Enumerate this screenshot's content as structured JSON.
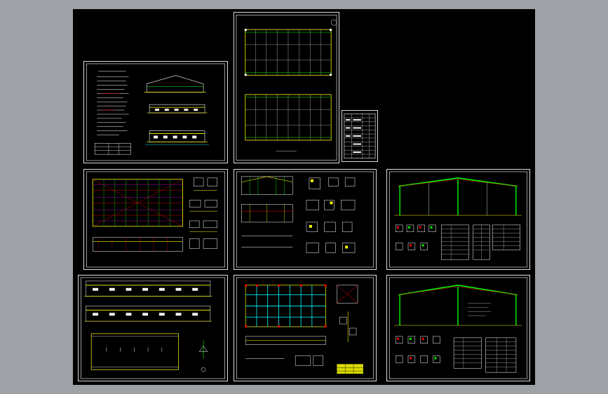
{
  "app": {
    "title": "",
    "background_color": "#9ea1a6",
    "canvas_color": "#000000"
  },
  "sheets": [
    {
      "id": "s1",
      "name": "design-notes-and-elevations"
    },
    {
      "id": "s2",
      "name": "foundation-and-column-layout"
    },
    {
      "id": "s3",
      "name": "drawing-index-table"
    },
    {
      "id": "s4",
      "name": "roof-bracing-plan"
    },
    {
      "id": "s5",
      "name": "wall-framing-details"
    },
    {
      "id": "s6",
      "name": "portal-frame-elevation-1"
    },
    {
      "id": "s7",
      "name": "building-elevations-and-plan"
    },
    {
      "id": "s8",
      "name": "purlin-layout-plan"
    },
    {
      "id": "s9",
      "name": "portal-frame-elevation-2"
    }
  ],
  "colors": {
    "line_white": "#ffffff",
    "line_yellow": "#ffff00",
    "line_green": "#00ff00",
    "line_red": "#ff0000",
    "line_cyan": "#00ffff",
    "line_magenta": "#ff00ff",
    "sheet_border": "#dcdcdc"
  }
}
